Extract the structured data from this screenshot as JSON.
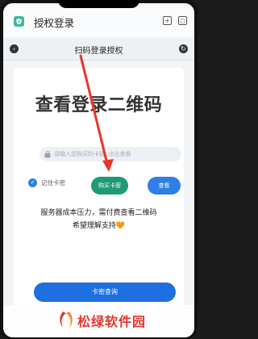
{
  "app": {
    "title": "授权登录",
    "icon": "shield-check-icon"
  },
  "nav": {
    "title": "扫码登录授权",
    "back_icon": "back-arrow-icon",
    "refresh_icon": "refresh-icon"
  },
  "main": {
    "heading": "查看登录二维码",
    "search_placeholder": "请输入您购买的卡密, 点击查看",
    "remember_label": "记住卡密",
    "buy_label": "购买卡密",
    "view_label": "查看",
    "notice_line1": "服务器成本压力，需付费查看二维码",
    "notice_line2": "希望理解支持🧡",
    "query_label": "卡密查询"
  },
  "watermark": {
    "text": "松绿软件园"
  },
  "colors": {
    "accent_blue": "#2f7fe6",
    "buy_green": "#1f9a75",
    "watermark_red": "#e8352b",
    "annotation_arrow": "#e8352b"
  }
}
